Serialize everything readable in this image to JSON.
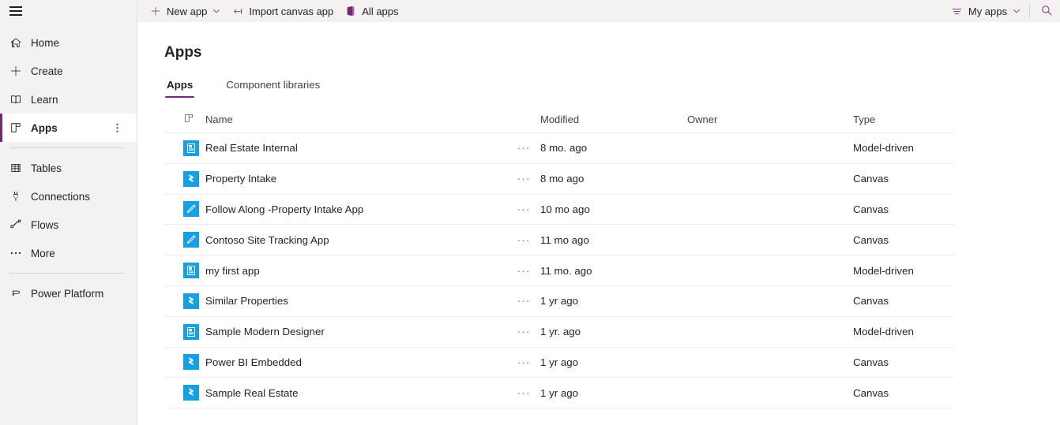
{
  "sidebar": {
    "menu_icon": "hamburger-icon",
    "items": [
      {
        "label": "Home",
        "icon": "home-icon",
        "active": false,
        "more": false
      },
      {
        "label": "Create",
        "icon": "plus-icon",
        "active": false,
        "more": false
      },
      {
        "label": "Learn",
        "icon": "book-icon",
        "active": false,
        "more": false
      },
      {
        "label": "Apps",
        "icon": "apps-grid-icon",
        "active": true,
        "more": true
      },
      {
        "label": "Tables",
        "icon": "table-icon",
        "active": false,
        "more": false
      },
      {
        "label": "Connections",
        "icon": "plug-icon",
        "active": false,
        "more": false
      },
      {
        "label": "Flows",
        "icon": "flow-icon",
        "active": false,
        "more": false
      },
      {
        "label": "More",
        "icon": "ellipsis-icon",
        "active": false,
        "more": false
      }
    ],
    "footer_item": {
      "label": "Power Platform",
      "icon": "power-platform-icon"
    },
    "more_glyph": "⋮",
    "accent_color": "#742774"
  },
  "commandbar": {
    "new_app": {
      "label": "New app",
      "icon": "plus-icon",
      "chevron": "⌄"
    },
    "import_canvas_app": {
      "label": "Import canvas app",
      "icon": "import-arrow-icon"
    },
    "all_apps": {
      "label": "All apps",
      "icon": "office-apps-icon"
    },
    "filter": {
      "label": "My apps",
      "icon": "filter-lines-icon",
      "chevron": "⌄"
    },
    "search": {
      "icon": "search-icon"
    }
  },
  "page": {
    "title": "Apps",
    "tabs": [
      {
        "label": "Apps",
        "active": true
      },
      {
        "label": "Component libraries",
        "active": false
      }
    ]
  },
  "table": {
    "columns": {
      "icon": "app-type-icon",
      "name": "Name",
      "modified": "Modified",
      "owner": "Owner",
      "type": "Type"
    },
    "row_menu_glyph": "···",
    "tile_color": "#14a0e3",
    "rows": [
      {
        "icon": "model-driven-app-icon",
        "name": "Real Estate Internal",
        "modified": "8 mo. ago",
        "owner": "",
        "type": "Model-driven"
      },
      {
        "icon": "canvas-app-icon",
        "name": "Property Intake",
        "modified": "8 mo ago",
        "owner": "",
        "type": "Canvas"
      },
      {
        "icon": "canvas-pen-app-icon",
        "name": "Follow Along -Property Intake App",
        "modified": "10 mo ago",
        "owner": "",
        "type": "Canvas"
      },
      {
        "icon": "canvas-pen-app-icon",
        "name": "Contoso Site Tracking App",
        "modified": "11 mo ago",
        "owner": "",
        "type": "Canvas"
      },
      {
        "icon": "model-driven-app-icon",
        "name": "my first app",
        "modified": "11 mo. ago",
        "owner": "",
        "type": "Model-driven"
      },
      {
        "icon": "canvas-app-icon",
        "name": "Similar Properties",
        "modified": "1 yr ago",
        "owner": "",
        "type": "Canvas"
      },
      {
        "icon": "model-driven-app-icon",
        "name": "Sample Modern Designer",
        "modified": "1 yr. ago",
        "owner": "",
        "type": "Model-driven"
      },
      {
        "icon": "canvas-app-icon",
        "name": "Power BI Embedded",
        "modified": "1 yr ago",
        "owner": "",
        "type": "Canvas"
      },
      {
        "icon": "canvas-app-icon",
        "name": "Sample Real Estate",
        "modified": "1 yr ago",
        "owner": "",
        "type": "Canvas"
      }
    ]
  }
}
